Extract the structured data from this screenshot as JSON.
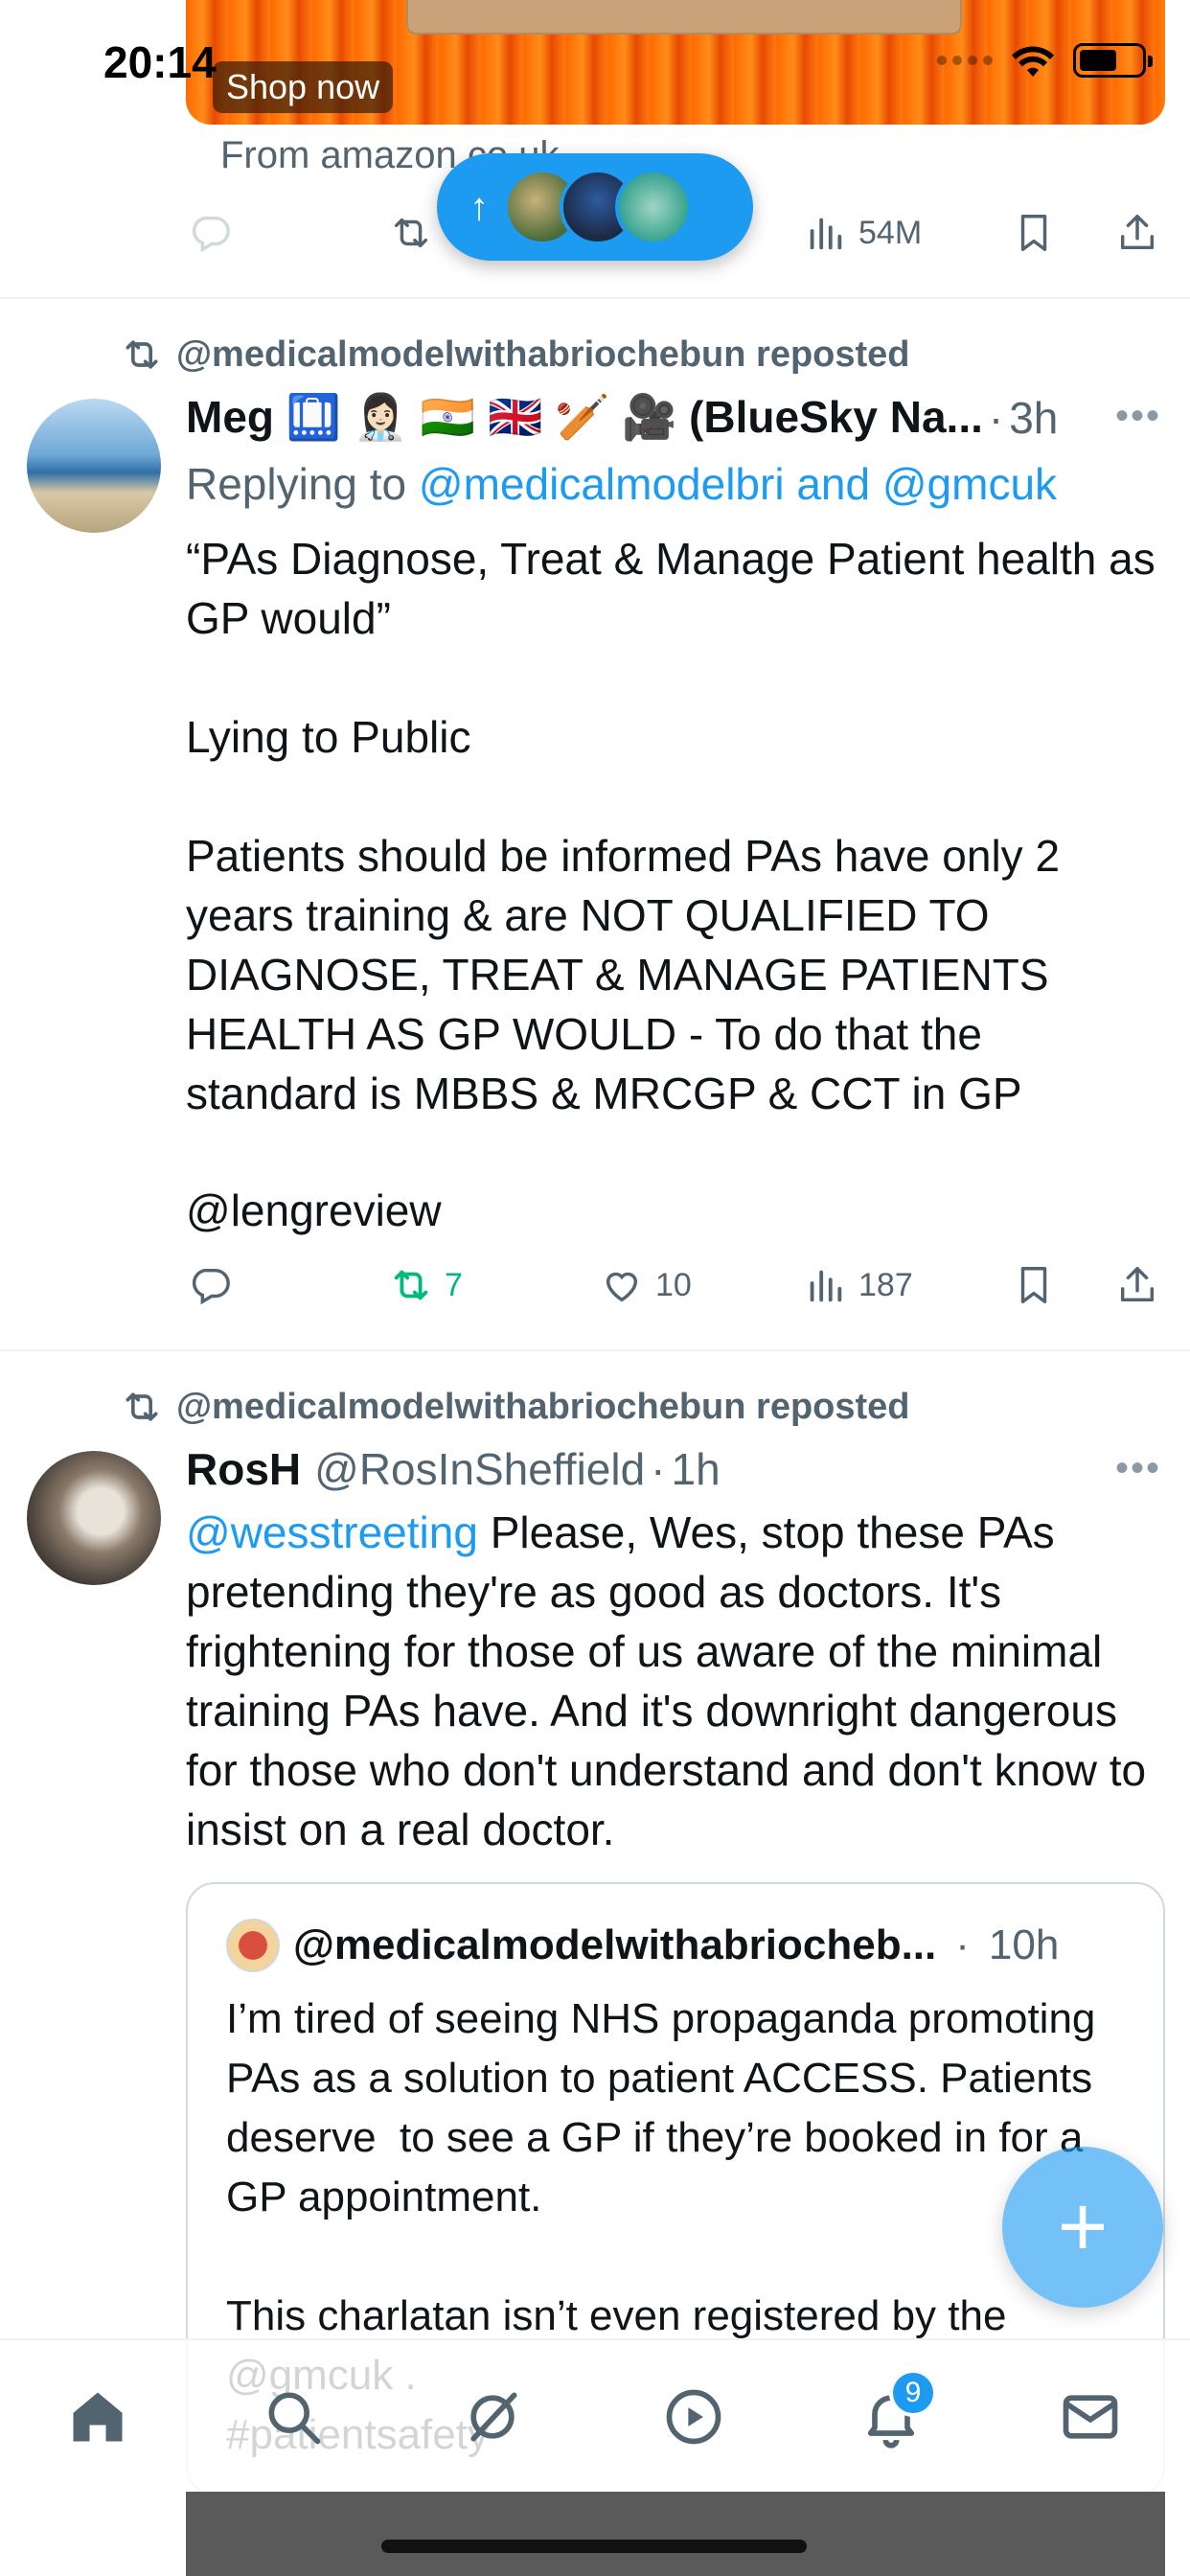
{
  "status_bar": {
    "time": "20:14"
  },
  "ad": {
    "cta": "Shop now",
    "source": "From amazon.co.uk",
    "actions": {
      "views": "54M"
    }
  },
  "new_posts_pill": {
    "icon": "arrow-up-icon"
  },
  "tweets": [
    {
      "repost_by": "@medicalmodelwithabriochebun reposted",
      "name": "Meg 🛄 👩🏻‍⚕️ 🇮🇳 🇬🇧 🏏 🎥 (BlueSky Na...",
      "handle": "",
      "time": "3h",
      "replying_prefix": "Replying to ",
      "replying_handles": "@medicalmodelbri and @gmcuk",
      "text": "“PAs Diagnose, Treat & Manage Patient health as GP would”\n\nLying to Public\n\nPatients should be informed PAs have only 2 years training & are NOT QUALIFIED TO DIAGNOSE, TREAT & MANAGE PATIENTS HEALTH AS GP WOULD - To do that the standard is MBBS & MRCGP & CCT in GP",
      "mention_link": "@lengreview",
      "counts": {
        "replies": "",
        "reposts": "7",
        "likes": "10",
        "views": "187"
      },
      "retweet_color": "#00ba7c"
    },
    {
      "repost_by": "@medicalmodelwithabriochebun reposted",
      "name": "RosH",
      "handle": "@RosInSheffield",
      "time": "1h",
      "mention": "@wesstreeting",
      "text": " Please, Wes, stop these PAs pretending they're as good as doctors. It's frightening for those of us aware of the minimal training PAs have. And it's downright dangerous for those who don't understand and don't know to insist on a real doctor.",
      "quote": {
        "name": "@medicalmodelwithabriocheb...",
        "time": "10h",
        "text": "I’m tired of seeing NHS propaganda promoting PAs as a solution to patient ACCESS. Patients deserve  to see a GP if they’re booked in for a GP appointment.\n\nThis charlatan isn’t even registered by the @gmcuk .\n#patientsafety"
      }
    }
  ],
  "tabbar": {
    "items": [
      "home-icon",
      "search-icon",
      "grok-icon",
      "play-icon",
      "bell-icon",
      "mail-icon"
    ],
    "notification_badge": "9"
  },
  "colors": {
    "accent": "#1d9bf0",
    "muted": "#536471",
    "repost_green": "#00ba7c"
  }
}
